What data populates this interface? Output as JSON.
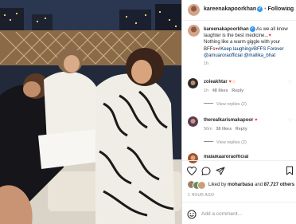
{
  "post": {
    "author": "kareenakapoorkhan",
    "follow_label": "Following",
    "more_label": "...",
    "caption_line1": "As we all know",
    "caption_line2": "laughter is the best medicine...",
    "caption_line3": "Nothing like a warm giggle with your",
    "caption_line4": "BFFs",
    "caption_tag": "#Keep laughing#BFFS Forever",
    "caption_mentions": "@amuaroraofficial @mallika_bhat",
    "caption_time": "1h"
  },
  "comments": [
    {
      "user": "zoieakhtar",
      "time": "1h",
      "likes": "48 likes",
      "reply": "Reply",
      "view_replies": "View replies (2)"
    },
    {
      "user": "therealkarismakapoor",
      "time": "56m",
      "likes": "38 likes",
      "reply": "Reply",
      "view_replies": "View replies (2)"
    },
    {
      "user": "malaikaaroraofficial"
    }
  ],
  "likes": {
    "prefix": "Liked by",
    "user": "moharbasu",
    "and": "and",
    "count": "87,727 others"
  },
  "timestamp": "1 HOUR AGO",
  "add_comment_placeholder": "Add a comment...",
  "colors": {
    "verified": "#3897f0",
    "heart": "#ed4956",
    "link": "#00376b"
  }
}
